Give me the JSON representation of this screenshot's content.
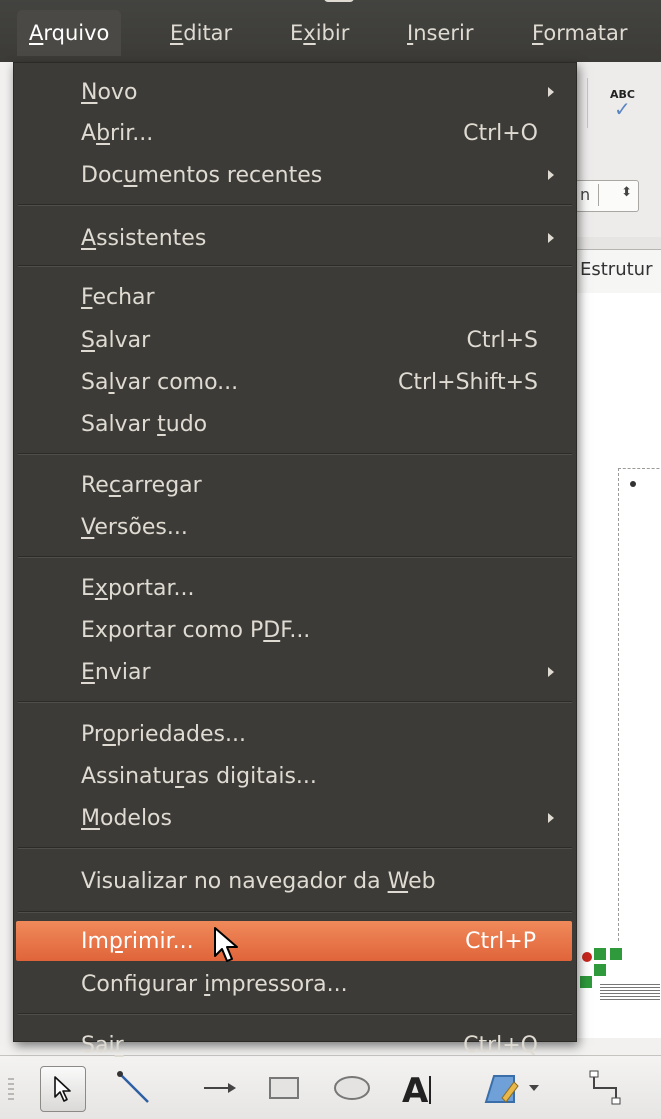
{
  "menubar": {
    "items": [
      {
        "pre": "",
        "u": "A",
        "post": "rquivo"
      },
      {
        "pre": "",
        "u": "E",
        "post": "ditar"
      },
      {
        "pre": "E",
        "u": "x",
        "post": "ibir"
      },
      {
        "pre": "",
        "u": "I",
        "post": "nserir"
      },
      {
        "pre": "",
        "u": "F",
        "post": "ormatar"
      }
    ]
  },
  "menu": {
    "novo": {
      "pre": "",
      "u": "N",
      "post": "ovo"
    },
    "abrir": {
      "pre": "A",
      "u": "b",
      "post": "rir...",
      "accel": "Ctrl+O"
    },
    "documentos": {
      "pre": "Doc",
      "u": "u",
      "post": "mentos recentes"
    },
    "assistentes": {
      "pre": "",
      "u": "A",
      "post": "ssistentes"
    },
    "fechar": {
      "pre": "",
      "u": "F",
      "post": "echar"
    },
    "salvar": {
      "pre": "",
      "u": "S",
      "post": "alvar",
      "accel": "Ctrl+S"
    },
    "salvar_como": {
      "pre": "Sa",
      "u": "l",
      "post": "var como...",
      "accel": "Ctrl+Shift+S"
    },
    "salvar_tudo": {
      "pre": "Salvar ",
      "u": "t",
      "post": "udo"
    },
    "recarregar": {
      "pre": "Re",
      "u": "c",
      "post": "arregar"
    },
    "versoes": {
      "pre": "",
      "u": "V",
      "post": "ersões..."
    },
    "exportar": {
      "pre": "E",
      "u": "x",
      "post": "portar..."
    },
    "exportar_pdf": {
      "pre": "Exportar como P",
      "u": "D",
      "post": "F..."
    },
    "enviar": {
      "pre": "",
      "u": "E",
      "post": "nviar"
    },
    "propriedades": {
      "pre": "Pr",
      "u": "o",
      "post": "priedades..."
    },
    "assinaturas": {
      "pre": "Assinatu",
      "u": "r",
      "post": "as digitais..."
    },
    "modelos": {
      "pre": "",
      "u": "M",
      "post": "odelos"
    },
    "visualizar": {
      "pre": "Visualizar no navegador da ",
      "u": "W",
      "post": "eb"
    },
    "imprimir": {
      "pre": "Im",
      "u": "p",
      "post": "rimir...",
      "accel": "Ctrl+P"
    },
    "configurar": {
      "pre": "Configurar ",
      "u": "i",
      "post": "mpressora..."
    },
    "sair": {
      "pre": "Sai",
      "u": "r",
      "post": "",
      "accel": "Ctrl+Q"
    }
  },
  "background": {
    "tab_label": "Estrutur",
    "toolbar_icon": "spellcheck-abc-icon"
  },
  "colors": {
    "menu_bg": "#3c3b37",
    "menu_text": "#dfdbd2",
    "highlight": "#e8734a"
  }
}
